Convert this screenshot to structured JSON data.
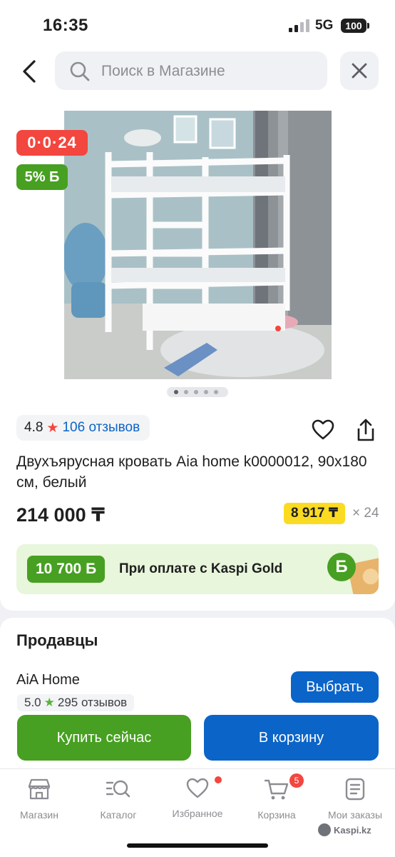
{
  "status_bar": {
    "time": "16:35",
    "network": "5G",
    "battery": "100"
  },
  "header": {
    "search_placeholder": "Поиск в Магазине"
  },
  "product": {
    "timer_badge": "0·0·24",
    "bonus_badge": "5% Б",
    "rating": "4.8",
    "reviews": "106 отзывов",
    "title": "Двухъярусная кровать Aia home k0000012, 90x180 см, белый",
    "price": "214 000 ₸",
    "monthly_payment": "8 917 ₸",
    "installment_months": "× 24",
    "gallery_page": 1,
    "gallery_total": 5
  },
  "promo": {
    "bonus_amount": "10 700 Б",
    "text": "При оплате с Kaspi Gold",
    "coin": "Б"
  },
  "sellers": {
    "heading": "Продавцы",
    "items": [
      {
        "name": "AiA Home",
        "rating": "5.0",
        "reviews": "295 отзывов",
        "choose_label": "Выбрать"
      }
    ]
  },
  "actions": {
    "buy_now": "Купить сейчас",
    "add_to_cart": "В корзину"
  },
  "tabbar": {
    "items": [
      {
        "label": "Магазин",
        "icon": "store-icon"
      },
      {
        "label": "Каталог",
        "icon": "catalog-search-icon"
      },
      {
        "label": "Избранное",
        "icon": "heart-icon",
        "dot": true
      },
      {
        "label": "Корзина",
        "icon": "cart-icon",
        "badge": "5"
      },
      {
        "label": "Мои заказы",
        "icon": "orders-icon"
      }
    ]
  },
  "watermark": "Kaspi.kz",
  "colors": {
    "red": "#f3463f",
    "green": "#47a021",
    "blue": "#0b64c8",
    "yellow": "#fbdb21"
  }
}
